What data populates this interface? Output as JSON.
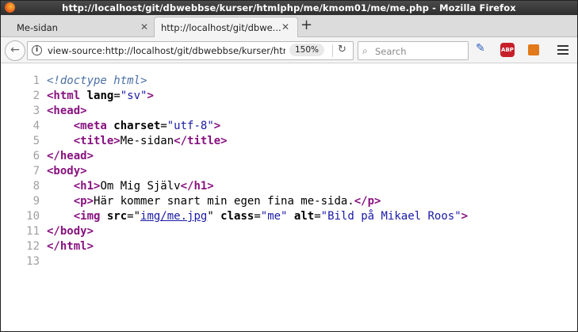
{
  "window": {
    "title": "http://localhost/git/dbwebbse/kurser/htmlphp/me/kmom01/me/me.php - Mozilla Firefox"
  },
  "tabs": [
    {
      "label": "Me-sidan"
    },
    {
      "label": "http://localhost/git/dbwe..."
    }
  ],
  "navbar": {
    "url": "view-source:http://localhost/git/dbwebbse/kurser/htn",
    "zoom": "150%",
    "search_placeholder": "Search",
    "abp_label": "ABP"
  },
  "source": {
    "line_numbers": [
      "1",
      "2",
      "3",
      "4",
      "5",
      "6",
      "7",
      "8",
      "9",
      "10",
      "11",
      "12",
      "13"
    ],
    "doctype": "<!doctype html>",
    "l2": {
      "open": "<html",
      "attr": " lang",
      "eq": "=",
      "val": "\"sv\"",
      "close": ">"
    },
    "l3": {
      "tag": "<head>"
    },
    "l4": {
      "open": "<meta",
      "attr": " charset",
      "eq": "=",
      "val": "\"utf-8\"",
      "close": ">"
    },
    "l5": {
      "open": "<title>",
      "text": "Me-sidan",
      "close": "</title>"
    },
    "l6": {
      "tag": "</head>"
    },
    "l7": {
      "tag": "<body>"
    },
    "l8": {
      "open": "<h1>",
      "text": "Om Mig Själv",
      "close": "</h1>"
    },
    "l9": {
      "open": "<p>",
      "text": "Här kommer snart min egen fina me-sida.",
      "close": "</p>"
    },
    "l10": {
      "open": "<img",
      "attr1": " src",
      "eq1": "=\"",
      "link": "img/me.jpg",
      "q1": "\"",
      "attr2": " class",
      "eq2": "=",
      "val2": "\"me\"",
      "attr3": " alt",
      "eq3": "=",
      "val3": "\"Bild på Mikael Roos\"",
      "close": ">"
    },
    "l11": {
      "tag": "</body>"
    },
    "l12": {
      "tag": "</html>"
    }
  }
}
